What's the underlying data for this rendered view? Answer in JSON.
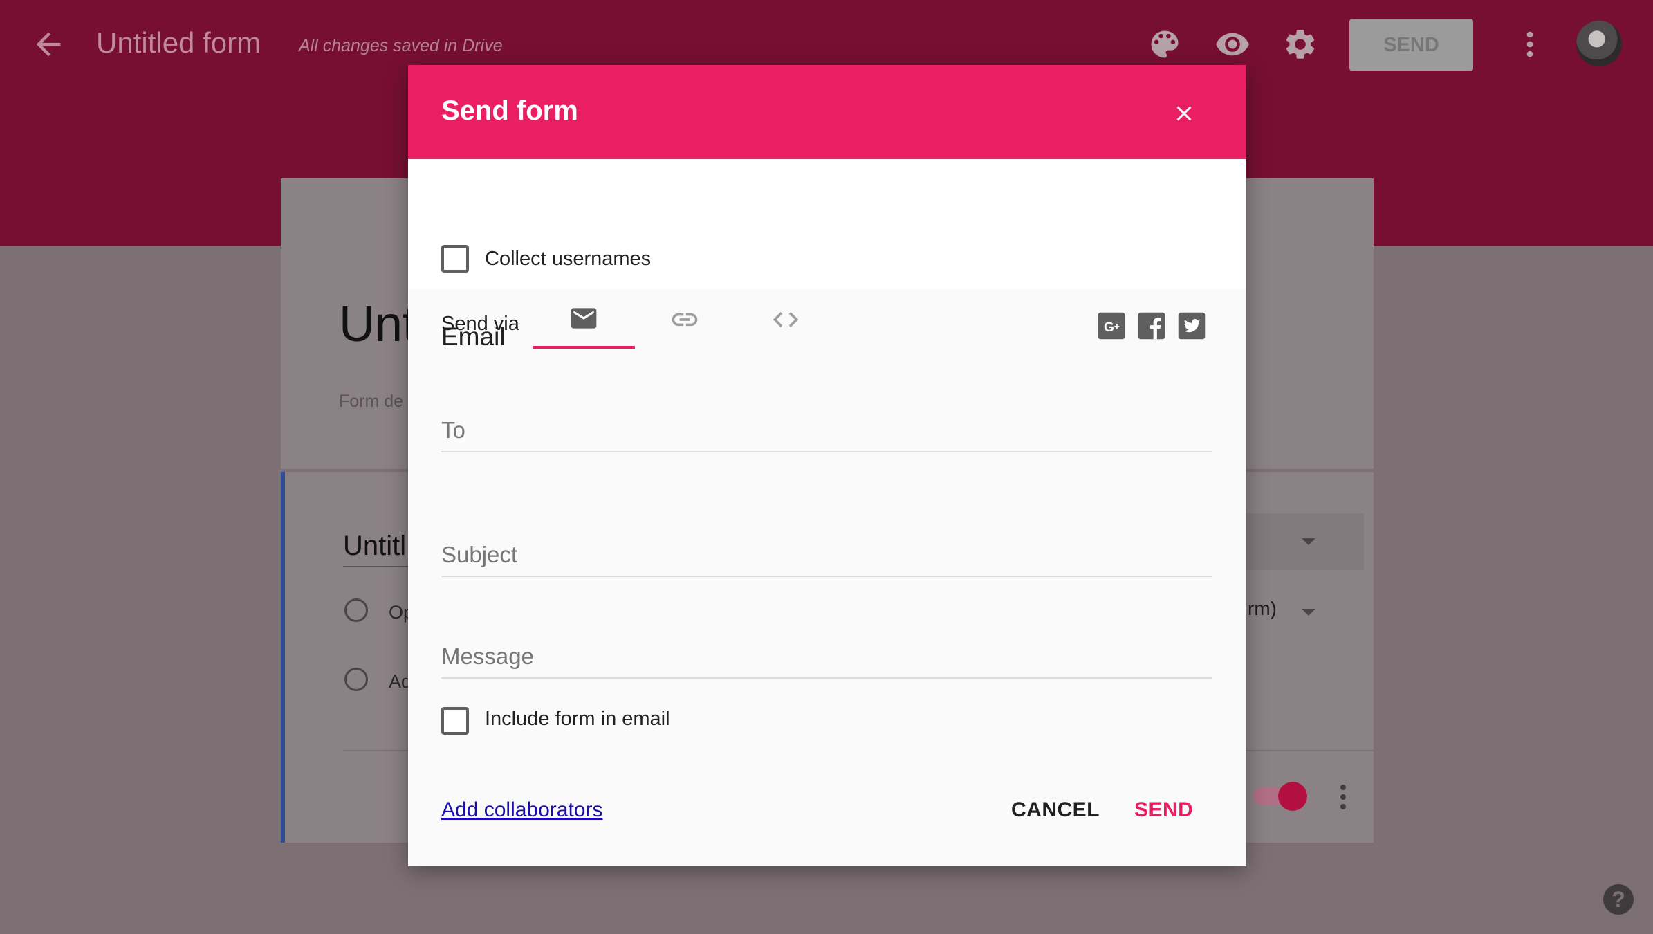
{
  "topbar": {
    "title": "Untitled form",
    "saved_status": "All changes saved in Drive",
    "send_label": "SEND",
    "icons": [
      "back-arrow-icon",
      "palette-icon",
      "eye-icon",
      "gear-icon",
      "more-vert-icon",
      "avatar"
    ],
    "bg_color": "#770f33"
  },
  "background_form": {
    "title_fragment": "Unt",
    "description_fragment": "Form de",
    "question_title_fragment": "Untitl",
    "option1_fragment": "Op",
    "option2_fragment": "Ad",
    "dropdown_fragment": "rm)"
  },
  "dialog": {
    "title": "Send form",
    "collect_usernames_label": "Collect usernames",
    "send_via_label": "Send via",
    "tabs": [
      "email-tab",
      "link-tab",
      "embed-tab"
    ],
    "active_tab": "email-tab",
    "share_icons": [
      "google-plus-icon",
      "facebook-icon",
      "twitter-icon"
    ],
    "section_heading": "Email",
    "to_placeholder": "To",
    "subject_placeholder": "Subject",
    "message_placeholder": "Message",
    "include_form_label": "Include form in email",
    "add_collaborators_label": "Add collaborators",
    "cancel_label": "CANCEL",
    "send_label": "SEND",
    "accent_color": "#e91e63"
  },
  "help": {
    "label": "?"
  }
}
